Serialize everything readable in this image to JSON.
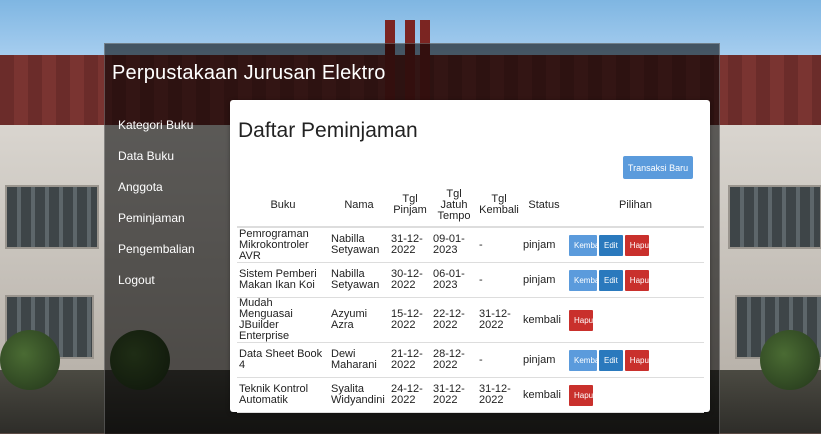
{
  "app": {
    "title": "Perpustakaan Jurusan Elektro"
  },
  "sidebar": {
    "items": [
      {
        "label": "Kategori Buku"
      },
      {
        "label": "Data Buku"
      },
      {
        "label": "Anggota"
      },
      {
        "label": "Peminjaman"
      },
      {
        "label": "Pengembalian"
      },
      {
        "label": "Logout"
      }
    ]
  },
  "main": {
    "title": "Daftar Peminjaman",
    "new_button": "Transaksi Baru",
    "table": {
      "headers": [
        "Buku",
        "Nama",
        "Tgl Pinjam",
        "Tgl Jatuh Tempo",
        "Tgl Kembali",
        "Status",
        "Pilihan"
      ],
      "rows": [
        {
          "buku": "Pemrograman Mikrokontroler AVR",
          "nama": "Nabilla Setyawan",
          "pinjam": "31-12-2022",
          "tempo": "09-01-2023",
          "kembali": "-",
          "status": "pinjam",
          "actions": [
            "Kembali",
            "Edit",
            "Hapus"
          ]
        },
        {
          "buku": "Sistem Pemberi Makan Ikan Koi",
          "nama": "Nabilla Setyawan",
          "pinjam": "30-12-2022",
          "tempo": "06-01-2023",
          "kembali": "-",
          "status": "pinjam",
          "actions": [
            "Kembali",
            "Edit",
            "Hapus"
          ]
        },
        {
          "buku": "Mudah Menguasai JBuilder Enterprise",
          "nama": "Azyumi Azra",
          "pinjam": "15-12-2022",
          "tempo": "22-12-2022",
          "kembali": "31-12-2022",
          "status": "kembali",
          "actions": [
            "Hapus"
          ]
        },
        {
          "buku": "Data Sheet Book 4",
          "nama": "Dewi Maharani",
          "pinjam": "21-12-2022",
          "tempo": "28-12-2022",
          "kembali": "-",
          "status": "pinjam",
          "actions": [
            "Kembali",
            "Edit",
            "Hapus"
          ]
        },
        {
          "buku": "Teknik Kontrol Automatik",
          "nama": "Syalita Widyandini",
          "pinjam": "24-12-2022",
          "tempo": "31-12-2022",
          "kembali": "31-12-2022",
          "status": "kembali",
          "actions": [
            "Hapus"
          ]
        }
      ]
    }
  },
  "colors": {
    "primary": "#5b9bdc",
    "edit": "#2a79bd",
    "danger": "#c9302c"
  }
}
